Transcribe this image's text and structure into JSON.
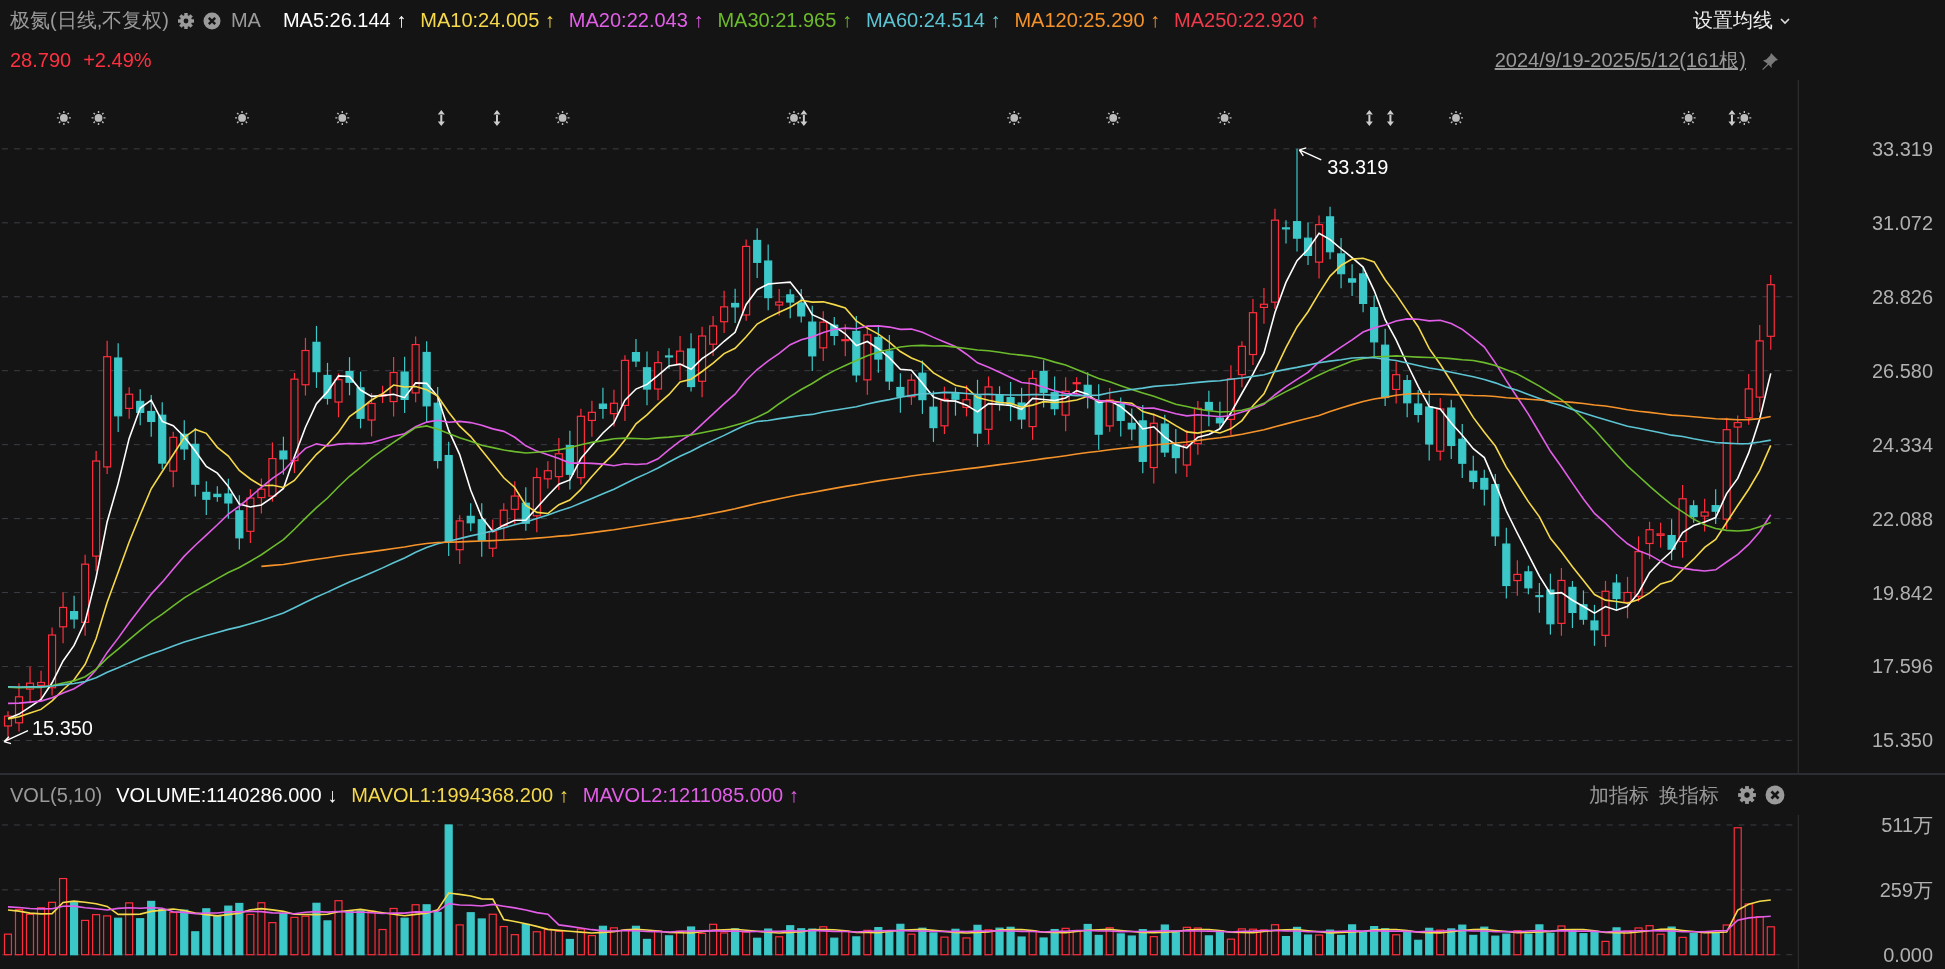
{
  "title": {
    "name": "极氮",
    "mode": "(日线,不复权)",
    "indicator": "MA"
  },
  "ma_legend": [
    {
      "label": "MA5:26.144",
      "arrow": "↑",
      "color": "#ffffff"
    },
    {
      "label": "MA10:24.005",
      "arrow": "↑",
      "color": "#f5d94a"
    },
    {
      "label": "MA20:22.043",
      "arrow": "↑",
      "color": "#e35ee8"
    },
    {
      "label": "MA30:21.965",
      "arrow": "↑",
      "color": "#6cbb2c"
    },
    {
      "label": "MA60:24.514",
      "arrow": "↑",
      "color": "#5cc4d2"
    },
    {
      "label": "MA120:25.290",
      "arrow": "↑",
      "color": "#f5932a"
    },
    {
      "label": "MA250:22.920",
      "arrow": "↑",
      "color": "#f03a4c"
    }
  ],
  "settings_menu": "设置均线",
  "price": {
    "value": "28.790",
    "change": "+2.49%"
  },
  "range": "2024/9/19-2025/5/12(161根)",
  "price_axis": [
    "33.319",
    "31.072",
    "28.826",
    "26.580",
    "24.334",
    "22.088",
    "19.842",
    "17.596",
    "15.350"
  ],
  "high_label": "33.319",
  "low_label": "15.350",
  "volume": {
    "name": "VOL(5,10)",
    "legend": [
      {
        "label": "VOLUME:1140286.000",
        "arrow": "↓",
        "color": "#ffffff"
      },
      {
        "label": "MAVOL1:1994368.200",
        "arrow": "↑",
        "color": "#f5d94a"
      },
      {
        "label": "MAVOL2:1211085.000",
        "arrow": "↑",
        "color": "#e35ee8"
      }
    ],
    "actions": [
      "加指标",
      "换指标"
    ],
    "axis": [
      "511万",
      "259万",
      "0.000"
    ]
  }
}
